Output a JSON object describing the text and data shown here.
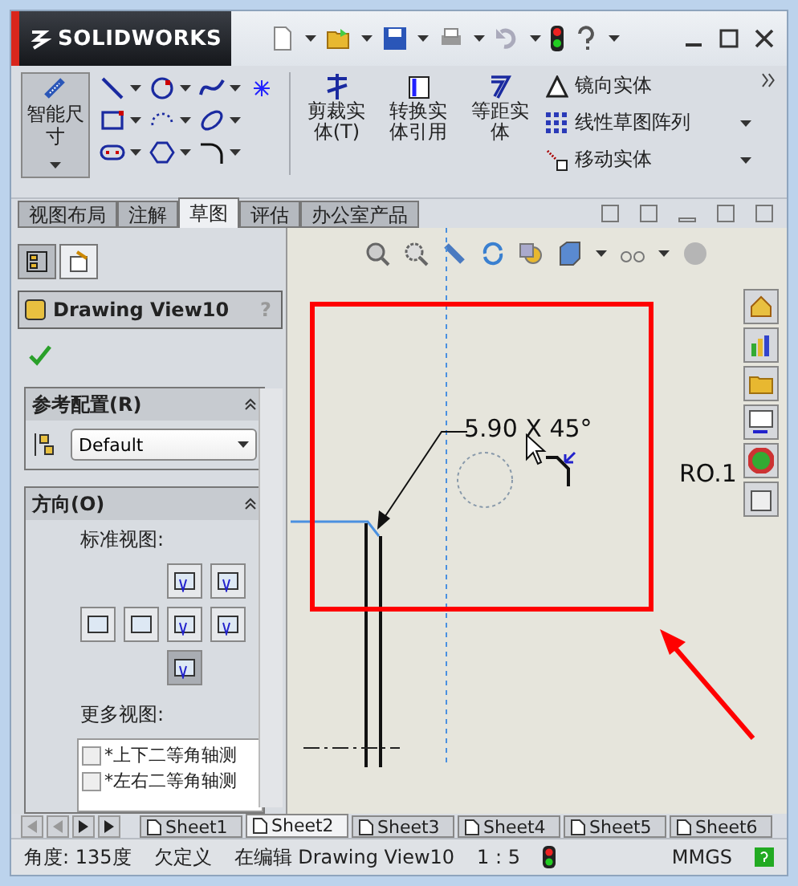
{
  "logo": "SOLIDWORKS",
  "smart_dimension": {
    "label": "智能尺寸",
    "selected": true
  },
  "commands": [
    {
      "label": "剪裁实体(T)"
    },
    {
      "label": "转换实体引用"
    },
    {
      "label": "等距实体"
    }
  ],
  "list_commands": [
    {
      "label": "镜向实体",
      "dropdown": false
    },
    {
      "label": "线性草图阵列",
      "dropdown": true
    },
    {
      "label": "移动实体",
      "dropdown": true
    }
  ],
  "tabs": [
    {
      "label": "视图布局",
      "selected": false
    },
    {
      "label": "注解",
      "selected": false
    },
    {
      "label": "草图",
      "selected": true
    },
    {
      "label": "评估",
      "selected": false
    },
    {
      "label": "办公室产品",
      "selected": false
    }
  ],
  "panel_tabs": [
    {
      "selected": false
    },
    {
      "selected": true
    }
  ],
  "property_panel": {
    "title": "Drawing View10",
    "help": "?"
  },
  "reference_config": {
    "title": "参考配置(R)",
    "value": "Default"
  },
  "orientation": {
    "title": "方向(O)",
    "standard_label": "标准视图:",
    "views": [
      {
        "selected": false
      },
      {
        "selected": false
      },
      {
        "selected": false
      },
      {
        "selected": false
      },
      {
        "selected": false
      },
      {
        "selected": false
      },
      {
        "selected": true
      }
    ],
    "more_label": "更多视图:",
    "more_views": [
      {
        "label": "*上下二等角轴测",
        "checked": false
      },
      {
        "label": "*左右二等角轴测",
        "checked": false
      }
    ]
  },
  "canvas": {
    "dimension": "5.90 X 45°",
    "side_text": "RO.1"
  },
  "sheets": [
    {
      "label": "Sheet1",
      "selected": false
    },
    {
      "label": "Sheet2",
      "selected": true
    },
    {
      "label": "Sheet3",
      "selected": false
    },
    {
      "label": "Sheet4",
      "selected": false
    },
    {
      "label": "Sheet5",
      "selected": false
    },
    {
      "label": "Sheet6",
      "selected": false
    }
  ],
  "status_bar": {
    "angle": "角度: 135度",
    "state": "欠定义",
    "editing": "在编辑 Drawing View10",
    "scale": "1 : 5",
    "units": "MMGS"
  }
}
